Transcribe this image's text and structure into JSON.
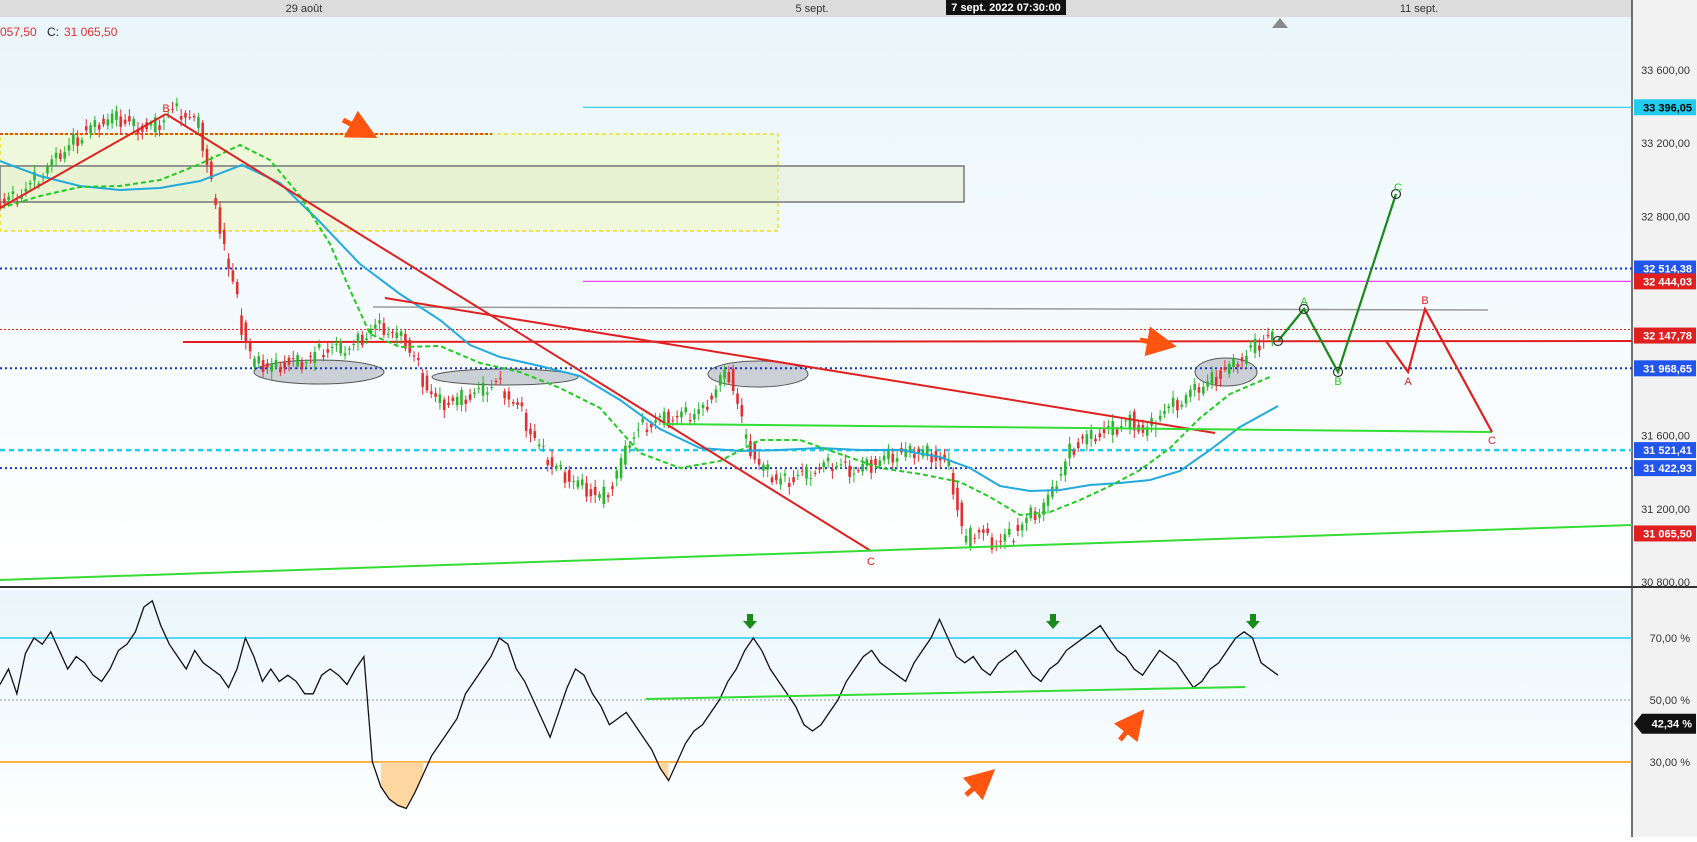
{
  "header": {
    "date_labels": [
      "29 août",
      "5 sept.",
      "11 sept."
    ],
    "cursor_date": "7 sept. 2022 07:30:00",
    "ohlc_left": "057,50",
    "close_label": "C:",
    "close_value": "31 065,50"
  },
  "colors": {
    "up": "#2db52d",
    "down": "#e03030",
    "blue_ma": "#22aadd",
    "green_ma": "#22cc22",
    "red_line": "#e02020",
    "green_line": "#33dd33",
    "dark_green": "#1a8a1a",
    "cyan": "#22ccee",
    "magenta": "#ee44ee",
    "dotted_blue": "#1133cc",
    "orange_arrow": "#ff5511",
    "rsi_overbought": "#22ccee",
    "rsi_oversold": "#ff9900"
  },
  "chart_data": [
    {
      "type": "candlestick",
      "price_axis": {
        "ylim": [
          30800,
          34000
        ],
        "ticks": [
          {
            "value": 33600,
            "label": "33 600,00"
          },
          {
            "value": 33200,
            "label": "33 200,00"
          },
          {
            "value": 32800,
            "label": "32 800,00"
          },
          {
            "value": 31600,
            "label": "31 600,00"
          },
          {
            "value": 31200,
            "label": "31 200,00"
          },
          {
            "value": 30800,
            "label": "30 800,00"
          }
        ]
      },
      "price_markers": [
        {
          "value": 33396.05,
          "label": "33 396,05",
          "bg": "#22ccee",
          "fg": "#000000"
        },
        {
          "value": 32514.38,
          "label": "32 514,38",
          "bg": "#2255ee",
          "fg": "#ffffff"
        },
        {
          "value": 32444.03,
          "label": "32 444,03",
          "bg": "#e02020",
          "fg": "#ffffff"
        },
        {
          "value": 32147.78,
          "label": "32 147,78",
          "bg": "#e02020",
          "fg": "#ffffff"
        },
        {
          "value": 31968.65,
          "label": "31 968,65",
          "bg": "#2255ee",
          "fg": "#ffffff"
        },
        {
          "value": 31521.41,
          "label": "31 521,41",
          "bg": "#2255ee",
          "fg": "#ffffff"
        },
        {
          "value": 31422.93,
          "label": "31 422,93",
          "bg": "#2255ee",
          "fg": "#ffffff"
        },
        {
          "value": 31065.5,
          "label": "31 065,50",
          "bg": "#e02020",
          "fg": "#ffffff"
        }
      ],
      "wave_labels": [
        {
          "text": "B",
          "color": "#e02020"
        },
        {
          "text": "C",
          "color": "#e02020"
        },
        {
          "text": "A",
          "color": "#22cc22"
        },
        {
          "text": "B",
          "color": "#22cc22"
        },
        {
          "text": "C",
          "color": "#22cc22"
        },
        {
          "text": "B",
          "color": "#e02020"
        },
        {
          "text": "A",
          "color": "#e02020"
        },
        {
          "text": "C",
          "color": "#e02020"
        }
      ],
      "series": [
        {
          "kind": "price",
          "values": [
            32880,
            32920,
            32980,
            33050,
            33120,
            33200,
            33260,
            33300,
            33340,
            33320,
            33300,
            33280,
            33330,
            33380,
            33350,
            33280,
            32900,
            32600,
            32250,
            32000,
            31980,
            31990,
            32000,
            32010,
            32050,
            32080,
            32070,
            32100,
            32180,
            32200,
            32150,
            32100,
            31950,
            31800,
            31780,
            31800,
            31820,
            31850,
            31900,
            31800,
            31700,
            31550,
            31450,
            31400,
            31350,
            31300,
            31250,
            31350,
            31550,
            31650,
            31680,
            31700,
            31700,
            31720,
            31750,
            31900,
            31950,
            31600,
            31450,
            31380,
            31350,
            31380,
            31400,
            31420,
            31450,
            31420,
            31420,
            31450,
            31480,
            31500,
            31500,
            31520,
            31480,
            31420,
            31000,
            31100,
            31020,
            31030,
            31080,
            31150,
            31200,
            31300,
            31500,
            31580,
            31600,
            31620,
            31650,
            31700,
            31600,
            31720,
            31750,
            31800,
            31850,
            31900,
            31950,
            32000,
            32050,
            32120,
            32150
          ]
        },
        {
          "kind": "rsi",
          "ylim": [
            0,
            100
          ],
          "ticks": [
            {
              "value": 70,
              "label": "70,00 %"
            },
            {
              "value": 50,
              "label": "50,00 %"
            },
            {
              "value": 30,
              "label": "30,00 %"
            }
          ],
          "current": {
            "value": 42.34,
            "label": "42,34 %"
          },
          "values": [
            55,
            60,
            52,
            65,
            70,
            68,
            72,
            66,
            60,
            64,
            62,
            58,
            56,
            60,
            66,
            68,
            72,
            80,
            82,
            74,
            68,
            64,
            60,
            66,
            62,
            60,
            58,
            54,
            60,
            70,
            64,
            56,
            60,
            56,
            58,
            56,
            52,
            52,
            58,
            60,
            58,
            55,
            60,
            64,
            30,
            22,
            18,
            16,
            15,
            20,
            26,
            32,
            36,
            40,
            44,
            52,
            56,
            60,
            64,
            70,
            68,
            60,
            56,
            50,
            44,
            38,
            46,
            54,
            60,
            58,
            52,
            48,
            42,
            44,
            46,
            42,
            38,
            34,
            28,
            24,
            30,
            36,
            40,
            42,
            46,
            50,
            56,
            60,
            66,
            70,
            66,
            60,
            56,
            52,
            48,
            42,
            40,
            42,
            46,
            50,
            56,
            60,
            64,
            66,
            62,
            60,
            58,
            56,
            62,
            66,
            70,
            76,
            70,
            64,
            62,
            64,
            60,
            58,
            62,
            64,
            66,
            62,
            58,
            56,
            60,
            62,
            66,
            68,
            70,
            72,
            74,
            70,
            66,
            64,
            60,
            58,
            62,
            66,
            64,
            62,
            58,
            54,
            56,
            60,
            62,
            66,
            70,
            72,
            70,
            62,
            60,
            58
          ]
        }
      ]
    }
  ]
}
